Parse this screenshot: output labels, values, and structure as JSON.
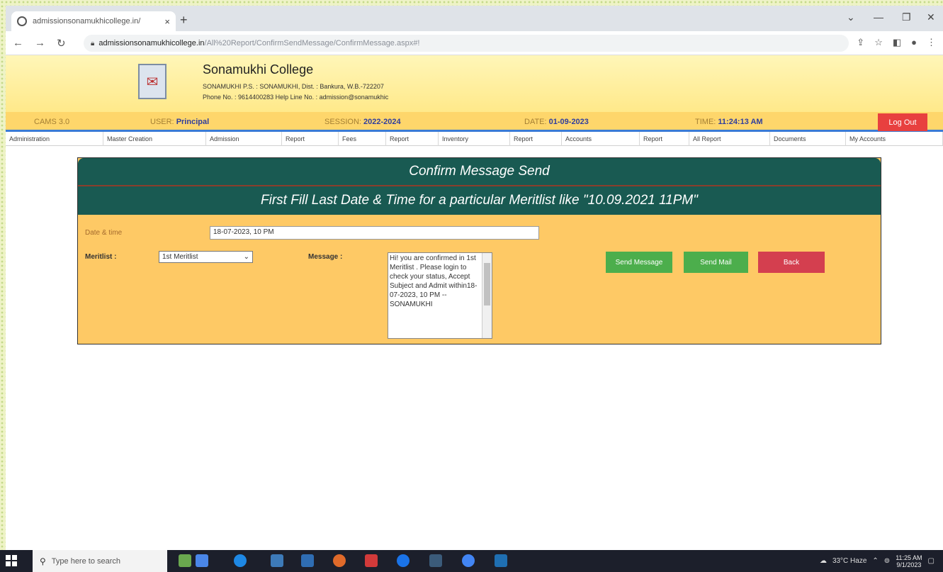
{
  "browser": {
    "tab_title": "admissionsonamukhicollege.in/",
    "tab_close": "×",
    "new_tab": "+",
    "url_host": "admissionsonamukhicollege.in",
    "url_path": "/All%20Report/ConfirmSendMessage/ConfirmMessage.aspx#!"
  },
  "header": {
    "college_name": "Sonamukhi College",
    "address": "SONAMUKHI P.S. : SONAMUKHI, Dist. : Bankura, W.B.-722207",
    "phone": "Phone No. : 9614400283  Help Line No. : admission@sonamukhic"
  },
  "infobar": {
    "cams": "CAMS 3.0",
    "user_label": "USER:",
    "user_value": "Principal",
    "session_label": "SESSION:",
    "session_value": "2022-2024",
    "date_label": "DATE:",
    "date_value": "01-09-2023",
    "time_label": "TIME:",
    "time_value": "11:24:13 AM",
    "logout_label": "Log Out"
  },
  "menu": {
    "items": [
      "Administration",
      "Master Creation",
      "Admission",
      "Report",
      "Fees",
      "Report",
      "Inventory",
      "Report",
      "Accounts",
      "Report",
      "All Report",
      "Documents",
      "My Accounts"
    ]
  },
  "panel": {
    "title": "Confirm Message Send",
    "subtitle": "First Fill Last Date & Time for a particular Meritlist like \"10.09.2021 11PM\"",
    "datetime_label": "Date & time",
    "datetime_value": "18-07-2023, 10 PM",
    "meritlist_label": "Meritlist :",
    "meritlist_selected": "1st Meritlist",
    "message_label": "Message :",
    "message_text": "Hi! you are confirmed in 1st Meritlist . Please login to check your status, Accept Subject and Admit within18-07-2023, 10 PM  --SONAMUKHI",
    "send_message_label": "Send Message",
    "send_mail_label": "Send Mail",
    "back_label": "Back"
  },
  "taskbar": {
    "search_placeholder": "Type here to search",
    "weather": "33°C  Haze",
    "clock_time": "11:25 AM",
    "clock_date": "9/1/2023"
  },
  "colors": {
    "panel_header": "#195a52",
    "panel_body": "#fec965",
    "infobar": "#fed66b",
    "logout": "#e8403f",
    "green_button": "#4cae4c",
    "red_button": "#d43f4f"
  }
}
